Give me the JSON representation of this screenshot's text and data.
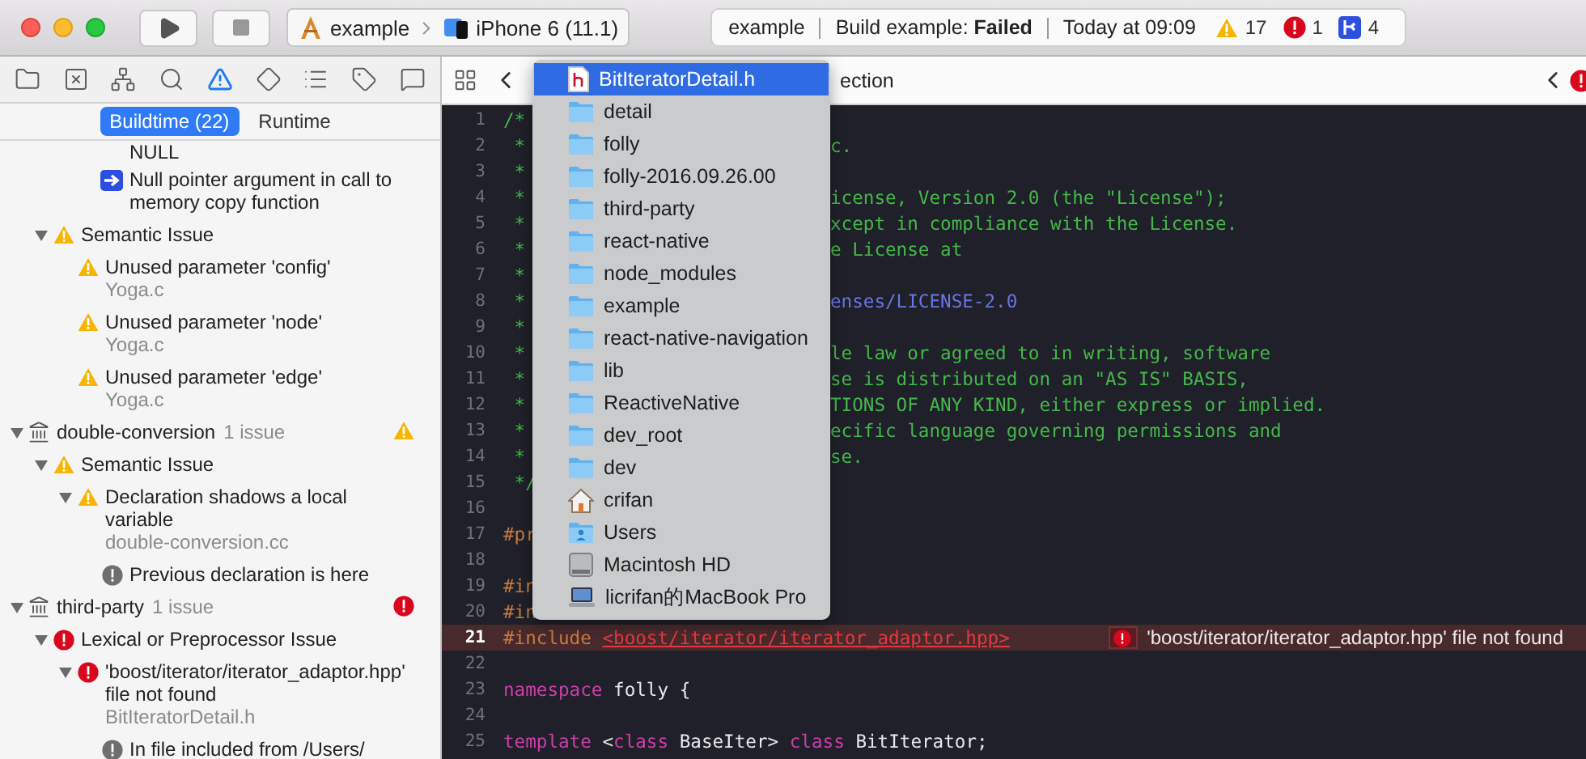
{
  "toolbar": {
    "scheme": "example",
    "device": "iPhone 6 (11.1)"
  },
  "activity": {
    "project": "example",
    "status": "Build example: **Failed**",
    "time": "Today at 09:09",
    "badges": [
      {
        "kind": "warning",
        "count": "17"
      },
      {
        "kind": "error",
        "count": "1"
      },
      {
        "kind": "analyzer",
        "count": "4"
      }
    ]
  },
  "navigator_tabs": [
    {
      "selected": false
    },
    {
      "selected": false
    },
    {
      "selected": false
    },
    {
      "selected": false
    },
    {
      "selected": true
    },
    {
      "selected": false
    },
    {
      "selected": false
    },
    {
      "selected": false
    },
    {
      "selected": false
    }
  ],
  "result_tabs": [
    {
      "label": "Buildtime (22)",
      "selected": true
    },
    {
      "label": "Runtime",
      "selected": false
    }
  ],
  "issue_tree": [
    {
      "kind": "offscreen",
      "children": [
        {
          "kind": "offscreen",
          "children": [
            {
              "kind": "offscreen",
              "children": [
                {
                  "kind": "tail",
                  "text": "NULL"
                },
                {
                  "kind": "step",
                  "text": "Null pointer argument in call to memory copy function"
                }
              ]
            }
          ]
        },
        {
          "kind": "warning-category",
          "expanded": true,
          "text": "Semantic Issue",
          "children": [
            {
              "kind": "warning-issue",
              "text": "Unused parameter 'config'",
              "file": "Yoga.c"
            },
            {
              "kind": "warning-issue",
              "text": "Unused parameter 'node'",
              "file": "Yoga.c"
            },
            {
              "kind": "warning-issue",
              "text": "Unused parameter 'edge'",
              "file": "Yoga.c"
            }
          ]
        }
      ]
    },
    {
      "kind": "warning-target",
      "expanded": true,
      "text": "double-conversion",
      "count": "1 issue",
      "children": [
        {
          "kind": "warning-category",
          "expanded": true,
          "text": "Semantic Issue",
          "children": [
            {
              "kind": "warning-issue",
              "expanded": true,
              "text": "Declaration shadows a local variable",
              "file": "double-conversion.cc",
              "children": [
                {
                  "kind": "note",
                  "text": "Previous declaration is here"
                }
              ]
            }
          ]
        }
      ]
    },
    {
      "kind": "error-target",
      "expanded": true,
      "text": "third-party",
      "count": "1 issue",
      "children": [
        {
          "kind": "error-category",
          "expanded": true,
          "text": "Lexical or Preprocessor Issue",
          "children": [
            {
              "kind": "error-issue",
              "expanded": true,
              "text": "'boost/iterator/iterator_adaptor.hpp' file not found",
              "file": "BitIteratorDetail.h",
              "children": [
                {
                  "kind": "note",
                  "text": "In file included from /Users/"
                }
              ]
            }
          ]
        }
      ]
    }
  ],
  "jump_bar": {
    "visible_text": "ection"
  },
  "path_menu": {
    "items": [
      {
        "kind": "header-file",
        "label": "BitIteratorDetail.h",
        "selected": true
      },
      {
        "kind": "folder",
        "label": "detail",
        "selected": false
      },
      {
        "kind": "folder",
        "label": "folly",
        "selected": false
      },
      {
        "kind": "folder",
        "label": "folly-2016.09.26.00",
        "selected": false
      },
      {
        "kind": "folder",
        "label": "third-party",
        "selected": false
      },
      {
        "kind": "folder",
        "label": "react-native",
        "selected": false
      },
      {
        "kind": "folder",
        "label": "node_modules",
        "selected": false
      },
      {
        "kind": "folder",
        "label": "example",
        "selected": false
      },
      {
        "kind": "folder",
        "label": "react-native-navigation",
        "selected": false
      },
      {
        "kind": "folder",
        "label": "lib",
        "selected": false
      },
      {
        "kind": "folder",
        "label": "ReactiveNative",
        "selected": false
      },
      {
        "kind": "folder",
        "label": "dev_root",
        "selected": false
      },
      {
        "kind": "folder",
        "label": "dev",
        "selected": false
      },
      {
        "kind": "home",
        "label": "crifan",
        "selected": false
      },
      {
        "kind": "users",
        "label": "Users",
        "selected": false
      },
      {
        "kind": "disk",
        "label": "Macintosh HD",
        "selected": false
      },
      {
        "kind": "computer",
        "label": "licrifan的MacBook Pro",
        "selected": false
      }
    ]
  },
  "code_lines": [
    {
      "number": "1",
      "tokens": [
        {
          "kind": "comment",
          "text": "/*"
        }
      ]
    },
    {
      "number": "2",
      "tokens": [
        {
          "kind": "comment",
          "text": " *"
        }
      ],
      "tokens_right": [
        {
          "kind": "comment",
          "text": "c."
        }
      ]
    },
    {
      "number": "3",
      "tokens": [
        {
          "kind": "comment",
          "text": " *"
        }
      ]
    },
    {
      "number": "4",
      "tokens": [
        {
          "kind": "comment",
          "text": " *"
        }
      ],
      "tokens_right": [
        {
          "kind": "comment",
          "text": "icense, Version 2.0 (the \"License\");"
        }
      ]
    },
    {
      "number": "5",
      "tokens": [
        {
          "kind": "comment",
          "text": " *"
        }
      ],
      "tokens_right": [
        {
          "kind": "comment",
          "text": "xcept in compliance with the License."
        }
      ]
    },
    {
      "number": "6",
      "tokens": [
        {
          "kind": "comment",
          "text": " *"
        }
      ],
      "tokens_right": [
        {
          "kind": "comment",
          "text": "e License at"
        }
      ]
    },
    {
      "number": "7",
      "tokens": [
        {
          "kind": "comment",
          "text": " *"
        }
      ]
    },
    {
      "number": "8",
      "tokens": [
        {
          "kind": "comment",
          "text": " *"
        }
      ],
      "tokens_right": [
        {
          "kind": "url",
          "text": "enses/LICENSE-2.0"
        }
      ]
    },
    {
      "number": "9",
      "tokens": [
        {
          "kind": "comment",
          "text": " *"
        }
      ]
    },
    {
      "number": "10",
      "tokens": [
        {
          "kind": "comment",
          "text": " *"
        }
      ],
      "tokens_right": [
        {
          "kind": "comment",
          "text": "le law or agreed to in writing, software"
        }
      ]
    },
    {
      "number": "11",
      "tokens": [
        {
          "kind": "comment",
          "text": " *"
        }
      ],
      "tokens_right": [
        {
          "kind": "comment",
          "text": "se is distributed on an \"AS IS\" BASIS,"
        }
      ]
    },
    {
      "number": "12",
      "tokens": [
        {
          "kind": "comment",
          "text": " *"
        }
      ],
      "tokens_right": [
        {
          "kind": "comment",
          "text": "TIONS OF ANY KIND, either express or implied."
        }
      ]
    },
    {
      "number": "13",
      "tokens": [
        {
          "kind": "comment",
          "text": " *"
        }
      ],
      "tokens_right": [
        {
          "kind": "comment",
          "text": "ecific language governing permissions and"
        }
      ]
    },
    {
      "number": "14",
      "tokens": [
        {
          "kind": "comment",
          "text": " *"
        }
      ],
      "tokens_right": [
        {
          "kind": "comment",
          "text": "se."
        }
      ]
    },
    {
      "number": "15",
      "tokens": [
        {
          "kind": "comment",
          "text": " */"
        }
      ]
    },
    {
      "number": "16"
    },
    {
      "number": "17",
      "tokens": [
        {
          "kind": "preprocessor",
          "text": "#pr"
        }
      ]
    },
    {
      "number": "18"
    },
    {
      "number": "19",
      "tokens": [
        {
          "kind": "preprocessor",
          "text": "#in"
        }
      ]
    },
    {
      "number": "20",
      "tokens": [
        {
          "kind": "preprocessor",
          "text": "#in"
        }
      ]
    },
    {
      "number": "21",
      "tokens": [
        {
          "kind": "preprocessor",
          "text": "#include "
        },
        {
          "kind": "error-string",
          "text": "<boost/iterator/iterator_adaptor.hpp>"
        }
      ],
      "error": "'boost/iterator/iterator_adaptor.hpp' file not found"
    },
    {
      "number": "22"
    },
    {
      "number": "23",
      "tokens": [
        {
          "kind": "keyword",
          "text": "namespace"
        },
        {
          "kind": "plain",
          "text": " folly {"
        }
      ]
    },
    {
      "number": "24"
    },
    {
      "number": "25",
      "tokens": [
        {
          "kind": "keyword",
          "text": "template"
        },
        {
          "kind": "plain",
          "text": " <"
        },
        {
          "kind": "keyword",
          "text": "class"
        },
        {
          "kind": "plain",
          "text": " BaseIter> "
        },
        {
          "kind": "keyword",
          "text": "class"
        },
        {
          "kind": "plain",
          "text": " BitIterator;"
        }
      ]
    }
  ]
}
